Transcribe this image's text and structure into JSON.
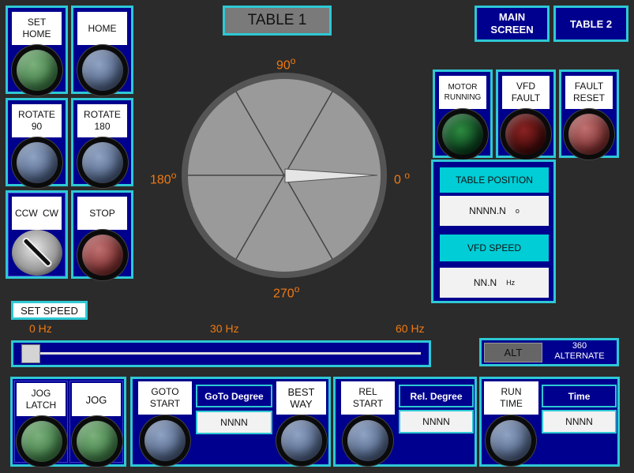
{
  "title": "TABLE 1",
  "nav": {
    "main_screen": "MAIN\nSCREEN",
    "table2": "TABLE 2"
  },
  "buttons": {
    "set_home": "SET\nHOME",
    "home": "HOME",
    "rotate90": "ROTATE\n90",
    "rotate180": "ROTATE\n180",
    "selector_ccw": "CCW",
    "selector_cw": "CW",
    "stop": "STOP",
    "motor_running": "MOTOR\nRUNNING",
    "vfd_fault": "VFD\nFAULT",
    "fault_reset": "FAULT\nRESET"
  },
  "dial": {
    "deg90": "90",
    "deg180": "180",
    "deg0": "0",
    "deg270": "270",
    "degree_symbol": "o"
  },
  "status_panel": {
    "table_position_label": "TABLE POSITION",
    "table_position_value": "NNNN.N",
    "table_position_unit": "o",
    "vfd_speed_label": "VFD SPEED",
    "vfd_speed_value": "NN.N",
    "vfd_speed_unit": "Hz"
  },
  "speed": {
    "set_speed_label": "SET SPEED",
    "min_label": "0 Hz",
    "mid_label": "30 Hz",
    "max_label": "60 Hz",
    "slider_value_fraction": 0.0
  },
  "alt": {
    "button": "ALT",
    "description": "360\nALTERNATE"
  },
  "bottom": {
    "jog_latch": "JOG\nLATCH",
    "jog": "JOG",
    "goto_start": "GOTO\nSTART",
    "goto_degree_header": "GoTo Degree",
    "goto_degree_value": "NNNN",
    "best_way": "BEST\nWAY",
    "rel_start": "REL\nSTART",
    "rel_degree_header": "Rel. Degree",
    "rel_degree_value": "NNNN",
    "run_time": "RUN\nTIME",
    "time_header": "Time",
    "time_value": "NNNN"
  },
  "colors": {
    "panel": "#00008e",
    "border": "#2ec8d4",
    "background": "#2b2b2b",
    "orange": "#f07a10"
  }
}
